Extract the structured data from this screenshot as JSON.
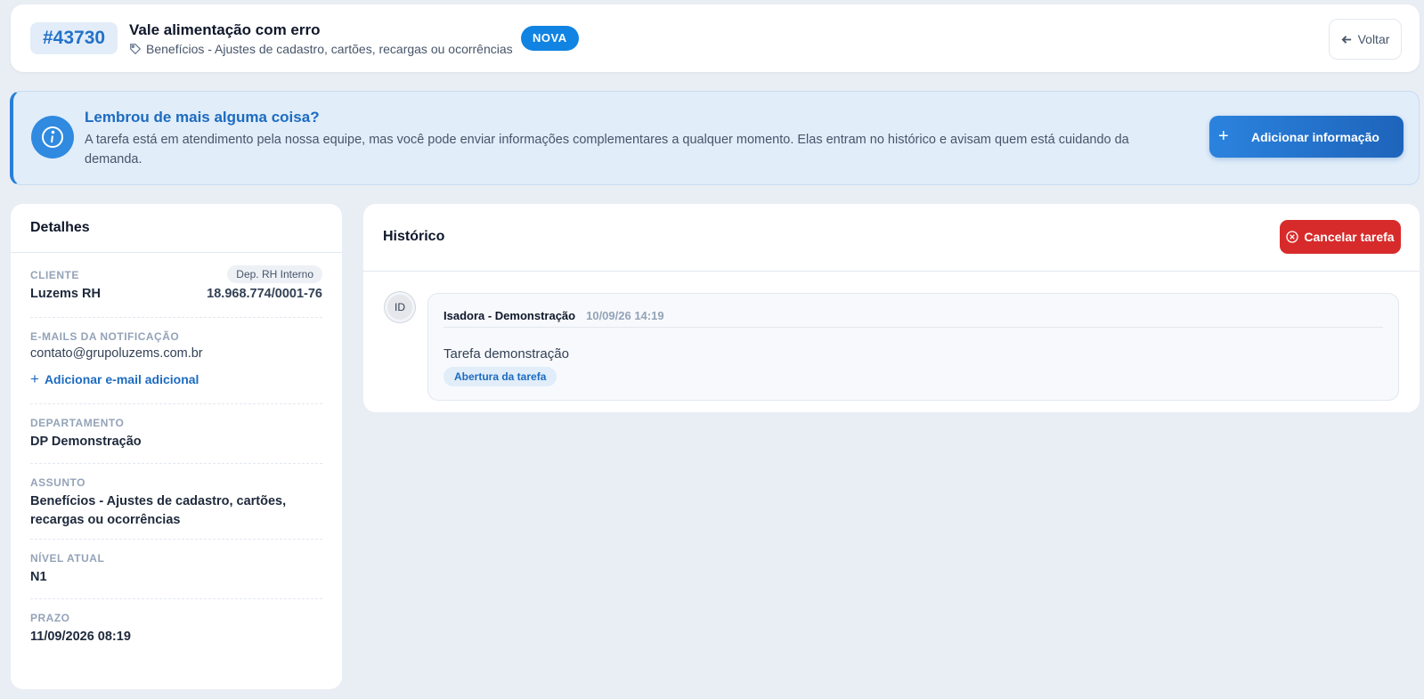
{
  "header": {
    "ticket_id": "#43730",
    "title": "Vale alimentação com erro",
    "subtitle": "Benefícios - Ajustes de cadastro, cartões, recargas ou ocorrências",
    "status_badge": "NOVA",
    "back_label": "Voltar"
  },
  "banner": {
    "title": "Lembrou de mais alguma coisa?",
    "text": "A tarefa está em atendimento pela nossa equipe, mas você pode enviar informações complementares a qualquer momento. Elas entram no histórico e avisam quem está cuidando da demanda.",
    "button_label": "Adicionar informação",
    "button_plus": "+"
  },
  "details": {
    "title": "Detalhes",
    "client_label": "CLIENTE",
    "client_badge": "Dep. RH Interno",
    "client_name": "Luzems RH",
    "client_cnpj": "18.968.774/0001-76",
    "emails_label": "E-MAILS DA NOTIFICAÇÃO",
    "email": "contato@grupoluzems.com.br",
    "add_email_plus": "+",
    "add_email_label": "Adicionar e-mail adicional",
    "department_label": "DEPARTAMENTO",
    "department": "DP Demonstração",
    "subject_label": "ASSUNTO",
    "subject": "Benefícios - Ajustes de cadastro, cartões, recargas ou ocorrências",
    "level_label": "NÍVEL ATUAL",
    "level": "N1",
    "deadline_label": "PRAZO",
    "deadline": "11/09/2026 08:19"
  },
  "history": {
    "title": "Histórico",
    "cancel_label": "Cancelar tarefa",
    "entries": [
      {
        "initials": "ID",
        "author": "Isadora - Demonstração",
        "time": "10/09/26 14:19",
        "text": "Tarefa demonstração",
        "tag": "Abertura da tarefa"
      }
    ]
  },
  "colors": {
    "accent": "#1c6bc0",
    "status_new": "#1183e2",
    "danger": "#d72b2b",
    "background": "#e9eef5"
  },
  "icons": {
    "tag": "tag-icon",
    "back": "arrow-left-icon",
    "info": "info-icon",
    "cancel": "x-circle-icon"
  }
}
